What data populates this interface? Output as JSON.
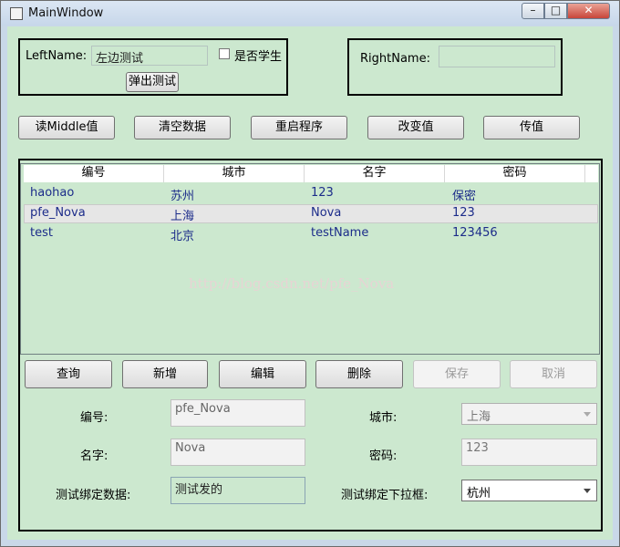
{
  "window": {
    "title": "MainWindow"
  },
  "left_panel": {
    "name_label": "LeftName:",
    "name_value": "左边测试",
    "checkbox_label": "是否学生",
    "popup_button": "弹出测试"
  },
  "right_panel": {
    "name_label": "RightName:",
    "name_value": ""
  },
  "toolbar": [
    "读Middle值",
    "清空数据",
    "重启程序",
    "改变值",
    "传值"
  ],
  "grid": {
    "columns": [
      "编号",
      "城市",
      "名字",
      "密码"
    ],
    "rows": [
      [
        "haohao",
        "苏州",
        "123",
        "保密"
      ],
      [
        "pfe_Nova",
        "上海",
        "Nova",
        "123"
      ],
      [
        "test",
        "北京",
        "testName",
        "123456"
      ]
    ],
    "selected_row": 1,
    "watermark": "http://blog.csdn.net/pfe_Nova"
  },
  "actions": [
    "查询",
    "新增",
    "编辑",
    "删除",
    "保存",
    "取消"
  ],
  "form": {
    "id_label": "编号:",
    "id_value": "pfe_Nova",
    "city_label": "城市:",
    "city_value": "上海",
    "name_label": "名字:",
    "name_value": "Nova",
    "password_label": "密码:",
    "password_value": "123",
    "bind_label": "测试绑定数据:",
    "bind_value": "测试发的",
    "combo_label": "测试绑定下拉框:",
    "combo_value": "杭州"
  },
  "colors": {
    "client_bg": "#cce8cf",
    "row_text": "#1c2c8a"
  }
}
